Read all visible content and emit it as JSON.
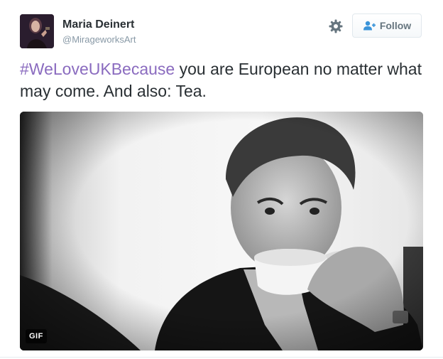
{
  "tweet": {
    "user": {
      "name": "Maria Deinert",
      "handle": "@MirageworksArt"
    },
    "follow_label": "Follow",
    "hashtag": "#WeLoveUKBecause",
    "text": " you are European no matter what may come. And also: Tea.",
    "media": {
      "badge": "GIF"
    }
  },
  "icons": {
    "settings": "gear-icon",
    "follow": "add-person-icon"
  },
  "colors": {
    "hashtag": "#8a6bbf",
    "name": "#292f33",
    "handle": "#8899a6",
    "follow_text": "#66757f",
    "button_border": "#e1e8ed"
  }
}
